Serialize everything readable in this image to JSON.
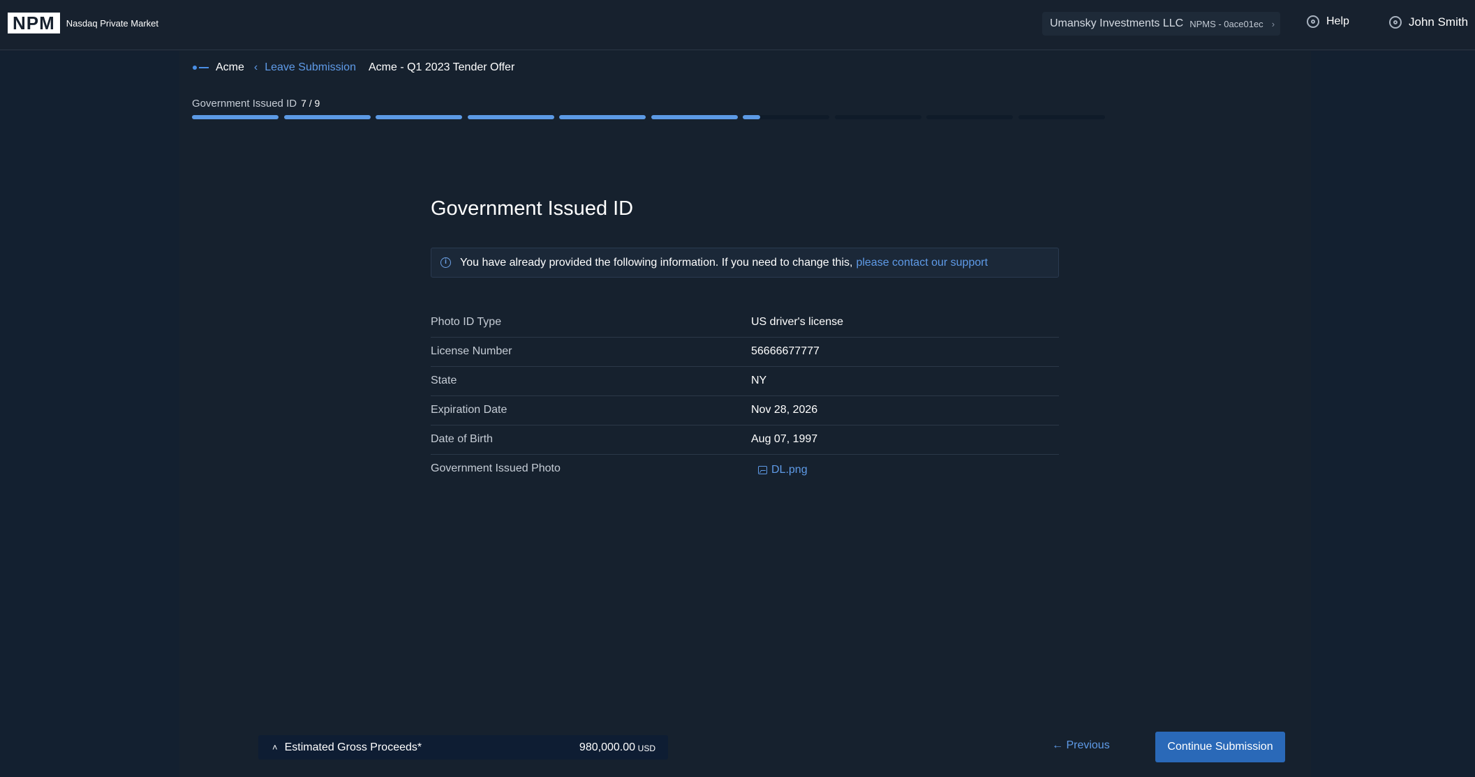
{
  "header": {
    "logo": "NPM",
    "brand": "Nasdaq Private Market",
    "account_name": "Umansky Investments LLC",
    "account_code": "NPMS - 0ace01ec",
    "help_label": "Help",
    "user_name": "John Smith"
  },
  "breadcrumb": {
    "company": "Acme",
    "leave": "Leave Submission",
    "title": "Acme - Q1 2023 Tender Offer"
  },
  "progress": {
    "label": "Government Issued ID",
    "count": "7 / 9",
    "segments": [
      1,
      1,
      1,
      1,
      1,
      1,
      0.2,
      0,
      0,
      0
    ]
  },
  "page": {
    "title": "Government Issued ID",
    "info_text": "You have already provided the following information. If you need to change this,",
    "info_link": "please contact our support"
  },
  "details": [
    {
      "label": "Photo ID Type",
      "value": "US driver's license"
    },
    {
      "label": "License Number",
      "value": "56666677777"
    },
    {
      "label": "State",
      "value": "NY"
    },
    {
      "label": "Expiration Date",
      "value": "Nov 28, 2026"
    },
    {
      "label": "Date of Birth",
      "value": "Aug 07, 1997"
    },
    {
      "label": "Government Issued Photo",
      "value": "DL.png"
    }
  ],
  "footer": {
    "proceeds_label": "Estimated Gross Proceeds*",
    "proceeds_value": "980,000.00",
    "proceeds_unit": "USD",
    "previous_label": "← Previous",
    "continue_label": "Continue Submission"
  },
  "colors": {
    "accent": "#5f9be8",
    "button": "#2a69b8",
    "background": "#17212e"
  }
}
